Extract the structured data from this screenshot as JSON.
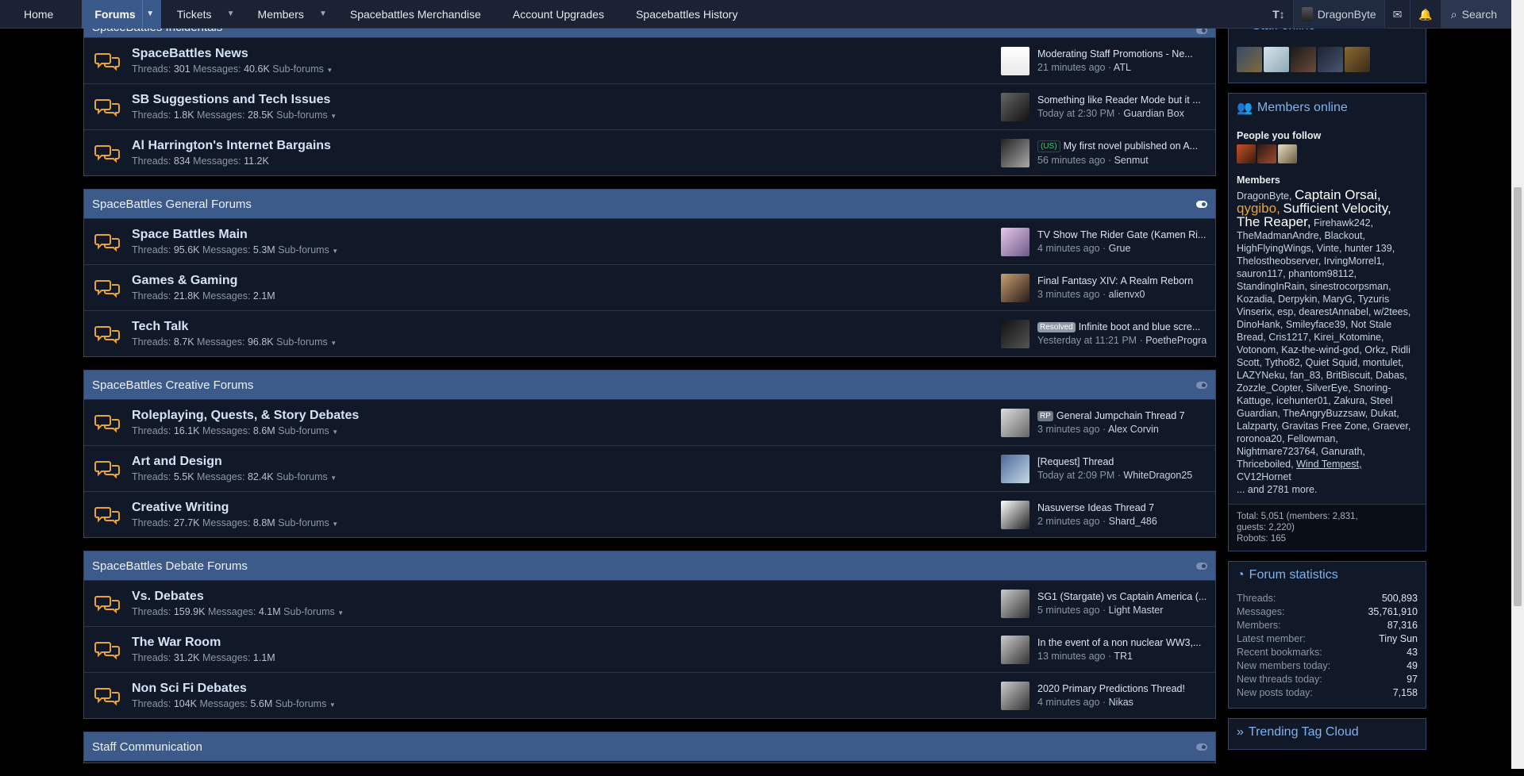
{
  "nav": {
    "tabs": [
      "Home",
      "Forums",
      "Tickets",
      "Members",
      "Spacebattles Merchandise",
      "Account Upgrades",
      "Spacebattles History"
    ],
    "user": "DragonByte",
    "search": "Search"
  },
  "categories": [
    {
      "title": "SpaceBattles Incidentals",
      "forums": [
        {
          "title": "SpaceBattles News",
          "threads": "301",
          "messages": "40.6K",
          "sub": "Sub-forums",
          "last_title": "Moderating Staff Promotions - Ne...",
          "last_time": "21 minutes ago",
          "last_user": "ATL",
          "prefix": ""
        },
        {
          "title": "SB Suggestions and Tech Issues",
          "threads": "1.8K",
          "messages": "28.5K",
          "sub": "Sub-forums",
          "last_title": "Something like Reader Mode but it ...",
          "last_time": "Today at 2:30 PM",
          "last_user": "Guardian Box",
          "prefix": ""
        },
        {
          "title": "Al Harrington's Internet Bargains",
          "threads": "834",
          "messages": "11.2K",
          "sub": "",
          "last_title": "My first novel published on A...",
          "last_time": "56 minutes ago",
          "last_user": "Senmut",
          "prefix": "(US)"
        }
      ]
    },
    {
      "title": "SpaceBattles General Forums",
      "forums": [
        {
          "title": "Space Battles Main",
          "threads": "95.6K",
          "messages": "5.3M",
          "sub": "Sub-forums",
          "last_title": "TV Show The Rider Gate (Kamen Ri...",
          "last_time": "4 minutes ago",
          "last_user": "Grue",
          "prefix": ""
        },
        {
          "title": "Games & Gaming",
          "threads": "21.8K",
          "messages": "2.1M",
          "sub": "",
          "last_title": "Final Fantasy XIV: A Realm Reborn",
          "last_time": "3 minutes ago",
          "last_user": "alienvx0",
          "prefix": ""
        },
        {
          "title": "Tech Talk",
          "threads": "8.7K",
          "messages": "96.8K",
          "sub": "Sub-forums",
          "last_title": "Infinite boot and blue scre...",
          "last_time": "Yesterday at 11:21 PM",
          "last_user": "PoetheProgra",
          "prefix": "Resolved"
        }
      ]
    },
    {
      "title": "SpaceBattles Creative Forums",
      "forums": [
        {
          "title": "Roleplaying, Quests, & Story Debates",
          "threads": "16.1K",
          "messages": "8.6M",
          "sub": "Sub-forums",
          "last_title": "General Jumpchain Thread 7",
          "last_time": "3 minutes ago",
          "last_user": "Alex Corvin",
          "prefix": "RP"
        },
        {
          "title": "Art and Design",
          "threads": "5.5K",
          "messages": "82.4K",
          "sub": "Sub-forums",
          "last_title": "[Request] Thread",
          "last_time": "Today at 2:09 PM",
          "last_user": "WhiteDragon25",
          "prefix": ""
        },
        {
          "title": "Creative Writing",
          "threads": "27.7K",
          "messages": "8.8M",
          "sub": "Sub-forums",
          "last_title": "Nasuverse Ideas Thread 7",
          "last_time": "2 minutes ago",
          "last_user": "Shard_486",
          "prefix": ""
        }
      ]
    },
    {
      "title": "SpaceBattles Debate Forums",
      "forums": [
        {
          "title": "Vs. Debates",
          "threads": "159.9K",
          "messages": "4.1M",
          "sub": "Sub-forums",
          "last_title": "SG1 (Stargate) vs Captain America (...",
          "last_time": "5 minutes ago",
          "last_user": "Light Master",
          "prefix": ""
        },
        {
          "title": "The War Room",
          "threads": "31.2K",
          "messages": "1.1M",
          "sub": "",
          "last_title": "In the event of a non nuclear WW3,...",
          "last_time": "13 minutes ago",
          "last_user": "TR1",
          "prefix": ""
        },
        {
          "title": "Non Sci Fi Debates",
          "threads": "104K",
          "messages": "5.6M",
          "sub": "Sub-forums",
          "last_title": "2020 Primary Predictions Thread!",
          "last_time": "4 minutes ago",
          "last_user": "Nikas",
          "prefix": ""
        }
      ]
    },
    {
      "title": "Staff Communication",
      "forums": []
    }
  ],
  "labels": {
    "threads": "Threads:",
    "messages": "Messages:"
  },
  "sidebar": {
    "staff_title": "Staff online",
    "members_title": "Members online",
    "people_follow": "People you follow",
    "members_label": "Members",
    "members_more": "... and 2781 more.",
    "total_line1": "Total: 5,051 (members: 2,831,",
    "total_line2": "guests: 2,220)",
    "total_line3": "Robots: 165",
    "stats_title": "Forum statistics",
    "stats": [
      {
        "label": "Threads:",
        "value": "500,893"
      },
      {
        "label": "Messages:",
        "value": "35,761,910"
      },
      {
        "label": "Members:",
        "value": "87,316"
      },
      {
        "label": "Latest member:",
        "value": "Tiny Sun"
      },
      {
        "label": "Recent bookmarks:",
        "value": "43"
      },
      {
        "label": "New members today:",
        "value": "49"
      },
      {
        "label": "New threads today:",
        "value": "97"
      },
      {
        "label": "New posts today:",
        "value": "7,158"
      }
    ],
    "trending_title": "Trending Tag Cloud"
  },
  "members_html_parts": {
    "a": "DragonByte,",
    "b": "Captain Orsai,",
    "c": "qygibo,",
    "d": "Sufficient Velocity, The Reaper,",
    "e": "Firehawk242, TheMadmanAndre, Blackout, HighFlyingWings, Vinte, hunter 139, Thelostheobserver, IrvingMorrel1, sauron117, phantom98112, StandingInRain, sinestrocorpsman, Kozadia, Derpykin, MaryG, Tyzuris Vinserix, esp, dearestAnnabel, w/2tees, DinoHank, Smileyface39, Not Stale Bread, Cris1217, Kirei_Kotomine, Votonom, Kaz-the-wind-god, Orkz, Ridli Scott, Tytho82, Quiet Squid, montulet, LAZYNeku, fan_83, BritBiscuit, Dabas, Zozzle_Copter, SilverEye, Snoring-Kattuge, icehunter01, Zakura, Steel Guardian, TheAngryBuzzsaw, Dukat, Lalzparty, Gravitas Free Zone, Graever, roronoa20, Fellowman, Nightmare723764, Ganurath, Thriceboiled,",
    "f": "Wind Tempest,",
    "g": "CV12Hornet"
  },
  "colors": {
    "accent": "#3c5a8a",
    "link": "#7fb2f0",
    "icon": "#e8a33a",
    "background": "#000000"
  }
}
